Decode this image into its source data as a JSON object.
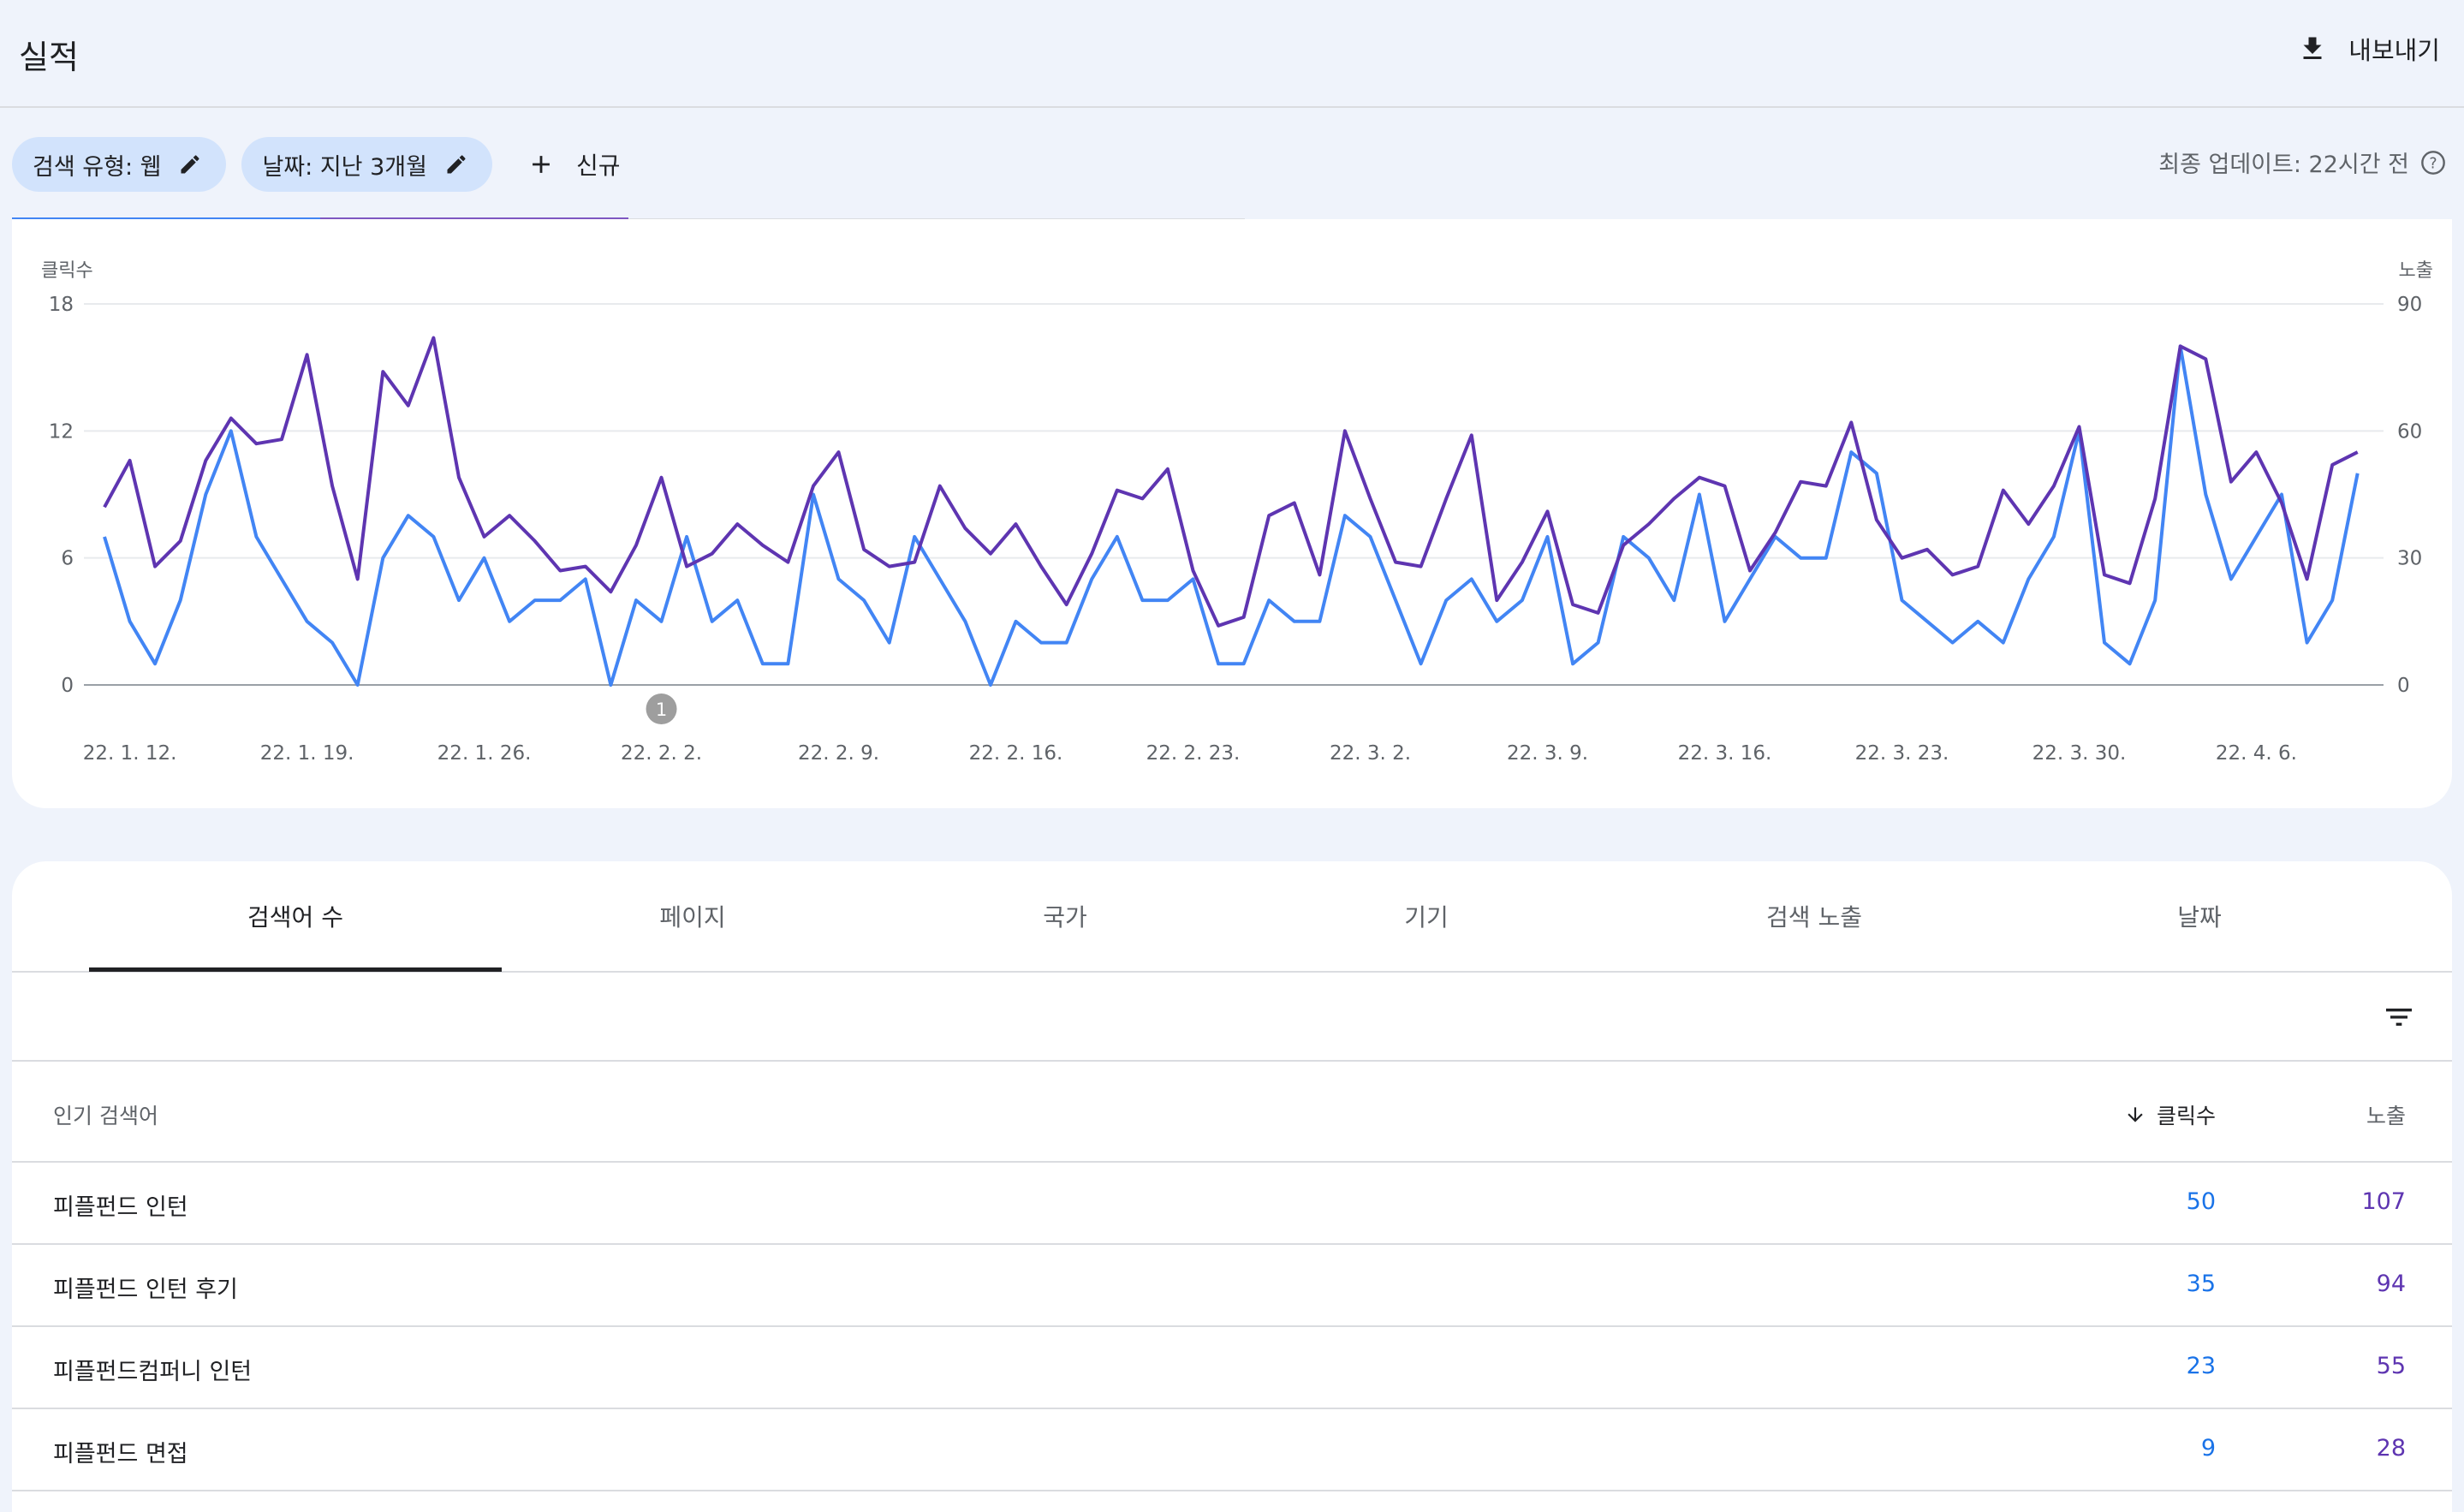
{
  "header": {
    "title": "실적",
    "export_label": "내보내기",
    "export_icon": "download-icon"
  },
  "filters": {
    "chips": [
      {
        "label": "검색 유형: 웹",
        "icon": "edit-icon"
      },
      {
        "label": "날짜: 지난 3개월",
        "icon": "edit-icon"
      }
    ],
    "new_label": "신규",
    "last_update": "최종 업데이트: 22시간 전",
    "help_icon": "help-icon"
  },
  "colors": {
    "clicks": "#4285f4",
    "impressions": "#5e35b1",
    "chip_bg": "#d2e3fc"
  },
  "chart_data": {
    "type": "line",
    "left_axis": {
      "label": "클릭수",
      "ticks": [
        "18",
        "12",
        "6",
        "0"
      ],
      "range": [
        0,
        18
      ]
    },
    "right_axis": {
      "label": "노출",
      "ticks": [
        "90",
        "60",
        "30",
        "0"
      ],
      "range": [
        0,
        90
      ]
    },
    "x_tick_labels": [
      "22. 1. 12.",
      "22. 1. 19.",
      "22. 1. 26.",
      "22. 2. 2.",
      "22. 2. 9.",
      "22. 2. 16.",
      "22. 2. 23.",
      "22. 3. 2.",
      "22. 3. 9.",
      "22. 3. 16.",
      "22. 3. 23.",
      "22. 3. 30.",
      "22. 4. 6."
    ],
    "annotation": {
      "label": "1",
      "date": "22. 2. 2."
    },
    "start_date": "22. 1. 11.",
    "grid": true,
    "series": [
      {
        "axis": "left",
        "values": [
          7,
          3,
          1,
          4,
          9,
          12,
          7,
          5,
          3,
          2,
          0,
          6,
          8,
          7,
          4,
          6,
          3,
          4,
          4,
          5,
          0,
          4,
          3,
          7,
          3,
          4,
          1,
          1,
          9,
          5,
          4,
          2,
          7,
          5,
          3,
          0,
          3,
          2,
          2,
          5,
          7,
          4,
          4,
          5,
          1,
          1,
          4,
          3,
          3,
          8,
          7,
          4,
          1,
          4,
          5,
          3,
          4,
          7,
          1,
          2,
          7,
          6,
          4,
          9,
          3,
          5,
          7,
          6,
          6,
          11,
          10,
          4,
          3,
          2,
          3,
          2,
          5,
          7,
          12,
          2,
          1,
          4,
          16,
          9,
          5,
          7,
          9,
          2,
          4,
          10
        ]
      },
      {
        "axis": "right",
        "values": [
          42,
          53,
          28,
          34,
          53,
          63,
          57,
          58,
          78,
          47,
          25,
          74,
          66,
          82,
          49,
          35,
          40,
          34,
          27,
          28,
          22,
          33,
          49,
          28,
          31,
          38,
          33,
          29,
          47,
          55,
          32,
          28,
          29,
          47,
          37,
          31,
          38,
          28,
          19,
          31,
          46,
          44,
          51,
          27,
          14,
          16,
          40,
          43,
          26,
          60,
          44,
          29,
          28,
          44,
          59,
          20,
          29,
          41,
          19,
          17,
          33,
          38,
          44,
          49,
          47,
          27,
          36,
          48,
          47,
          62,
          39,
          30,
          32,
          26,
          28,
          46,
          38,
          47,
          61,
          26,
          24,
          44,
          80,
          77,
          48,
          55,
          43,
          25,
          52,
          55
        ]
      }
    ]
  },
  "table": {
    "tabs": [
      "검색어 수",
      "페이지",
      "국가",
      "기기",
      "검색 노출",
      "날짜"
    ],
    "active_tab": "검색어 수",
    "filter_icon": "filter-list-icon",
    "columns": {
      "query": "인기 검색어",
      "clicks": "클릭수",
      "impressions": "노출",
      "sort_icon": "arrow-down-icon"
    },
    "rows": [
      {
        "query": "피플펀드 인턴",
        "clicks": "50",
        "impressions": "107"
      },
      {
        "query": "피플펀드 인턴 후기",
        "clicks": "35",
        "impressions": "94"
      },
      {
        "query": "피플펀드컴퍼니 인턴",
        "clicks": "23",
        "impressions": "55"
      },
      {
        "query": "피플펀드 면접",
        "clicks": "9",
        "impressions": "28"
      }
    ]
  }
}
